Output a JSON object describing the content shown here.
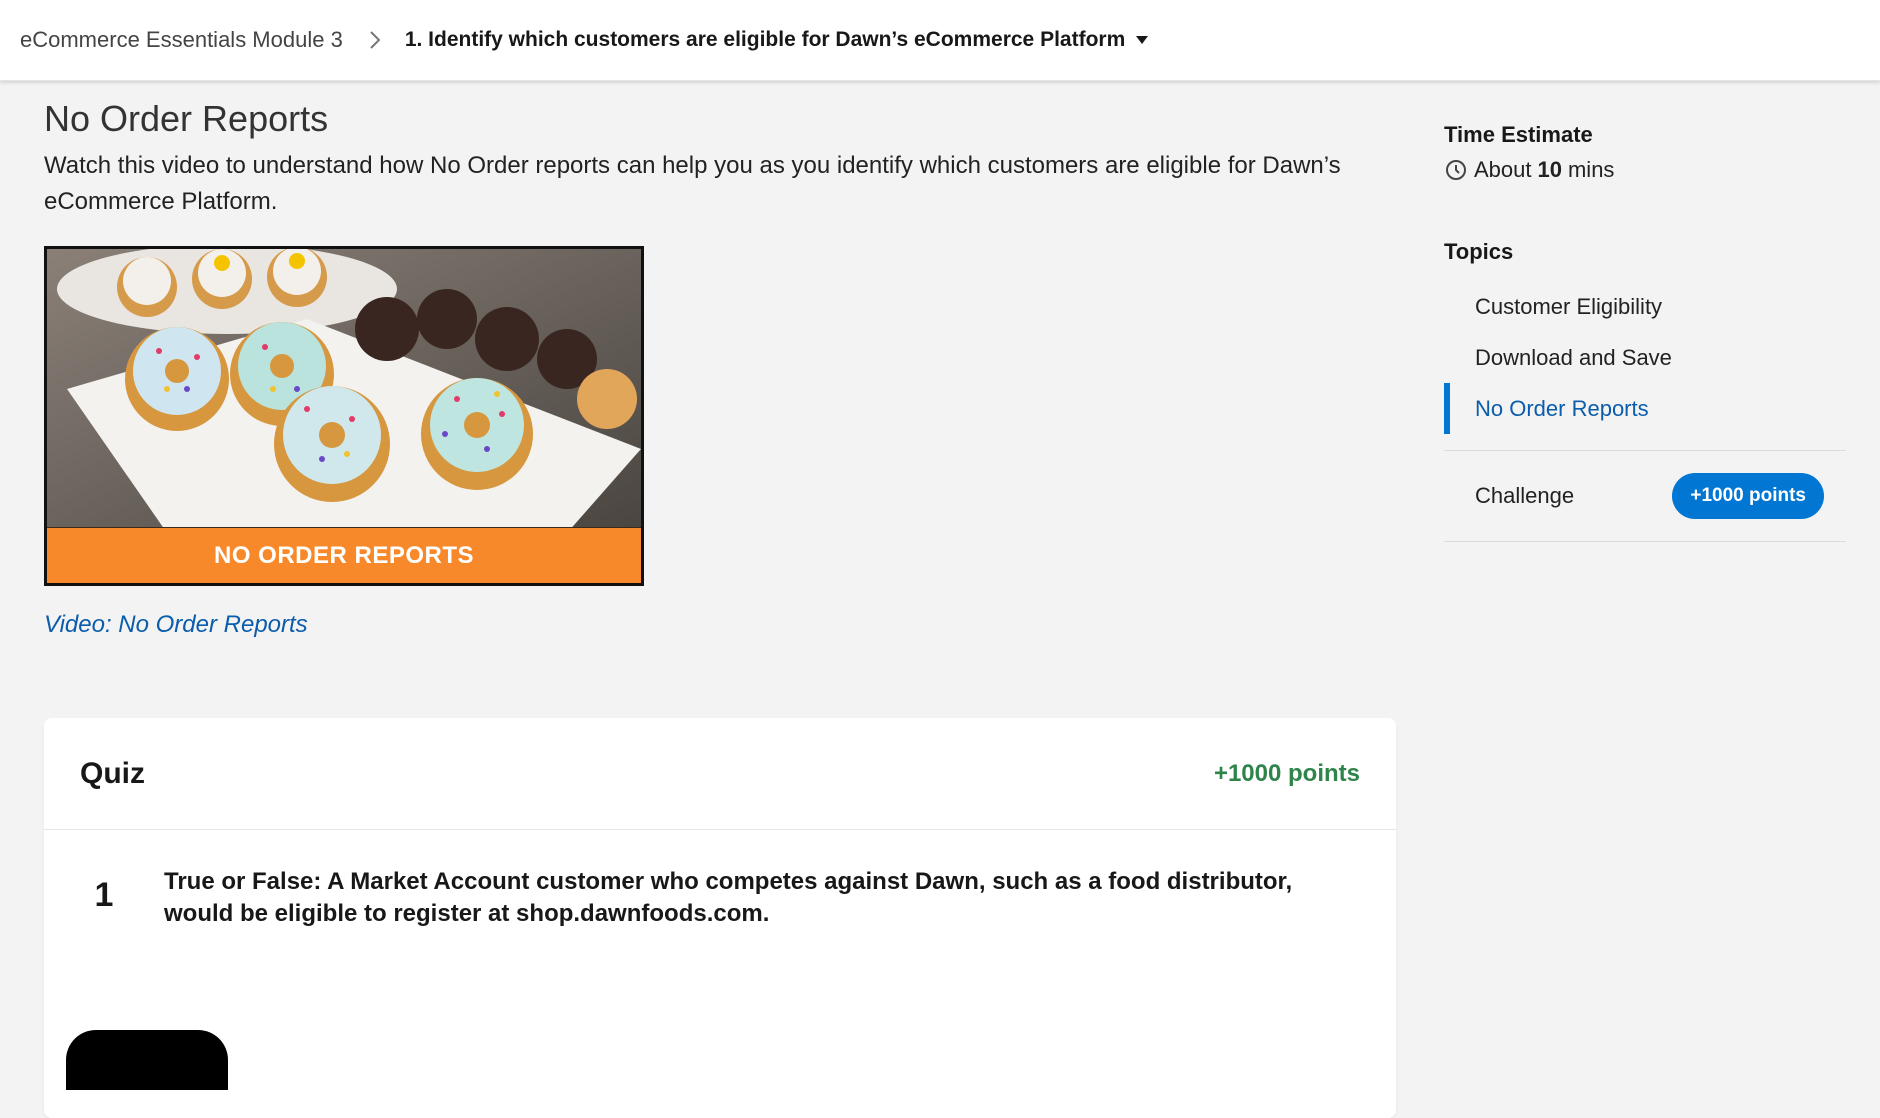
{
  "breadcrumb": {
    "module": "eCommerce Essentials Module 3",
    "unit": "1. Identify which customers are eligible for Dawn’s eCommerce Platform"
  },
  "unit": {
    "title": "No Order Reports",
    "description": "Watch this video to understand how No Order reports can help you as you identify which customers are eligible for Dawn’s eCommerce Platform.",
    "video_banner": "NO ORDER REPORTS",
    "video_link": "Video: No Order Reports"
  },
  "quiz": {
    "title": "Quiz",
    "points": "+1000 points",
    "questions": [
      {
        "number": "1",
        "text": "True or False: A Market Account customer who competes against Dawn, such as a food distributor, would be eligible to register at shop.dawnfoods.com."
      }
    ]
  },
  "sidebar": {
    "time_estimate_label": "Time Estimate",
    "time_prefix": "About",
    "time_value": "10",
    "time_suffix": "mins",
    "topics_label": "Topics",
    "topics": [
      {
        "label": "Customer Eligibility",
        "active": false
      },
      {
        "label": "Download and Save",
        "active": false
      },
      {
        "label": "No Order Reports",
        "active": true
      }
    ],
    "challenge_label": "Challenge",
    "challenge_points": "+1000 points"
  },
  "colors": {
    "accent_blue": "#0176d3",
    "link_blue": "#0b5cab",
    "points_green": "#2e844a",
    "video_band_orange": "#f7892a"
  },
  "icons": [
    "chevron-right-icon",
    "caret-down-icon",
    "clock-icon"
  ]
}
